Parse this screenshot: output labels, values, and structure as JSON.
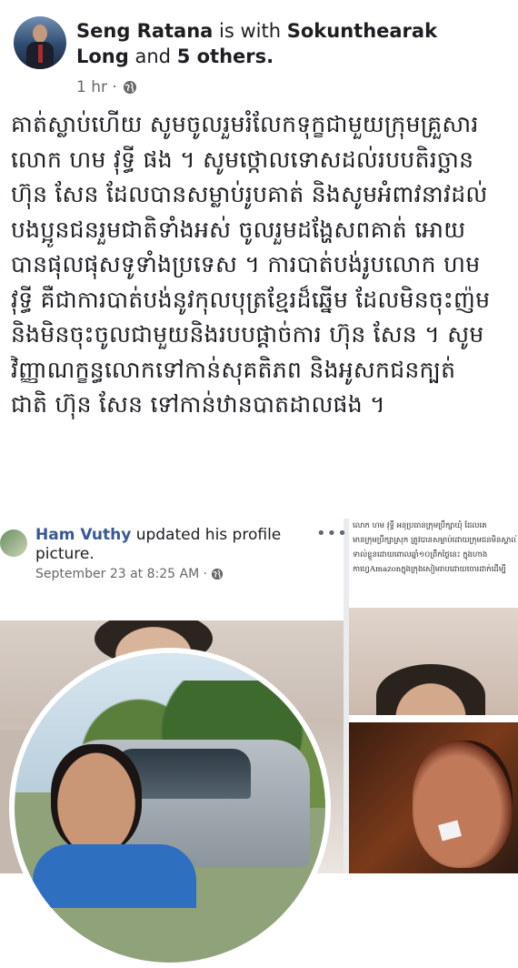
{
  "post": {
    "author": "Seng Ratana",
    "with_word": "is with",
    "tagged": "Sokunthearak",
    "tagged2": "Long",
    "and_word": "and",
    "others": "5 others.",
    "time": "1 hr ·",
    "privacy_icon": "globe-icon",
    "lines": [
      "គាត់ស្លាប់ហើយ សូមចូលរួមរំលែកទុក្ខជាមួយក្រុមគ្រួសារ",
      "លោក ហម វុទ្ធី ផង ។ សូមថ្កោលទោសដល់របបតិរច្ឆាន",
      "ហ៊ុន សែន ដែលបានសម្លាប់រូបគាត់ និងសូមអំពាវនាវដល់",
      "បងប្អូនជនរួមជាតិទាំងអស់ ចូលរួមដង្ហែសពគាត់ អោយ",
      "បានផុលផុសទូទាំងប្រទេស ។ ការបាត់បង់រូបលោក ហម",
      "វុទ្ធី គឺជាការបាត់បង់នូវកុលបុត្រខ្មែរដ៏ឆ្នើម ដែលមិនចុះញ៉ម",
      "និងមិនចុះចូលជាមួយនិងរបបផ្តាច់ការ ហ៊ុន សែន ។ សូម",
      "វិញ្ញាណក្ខន្ធលោកទៅកាន់សុគតិភព និងអូសកជនក្បត់",
      "ជាតិ ហ៊ុន សែន ទៅកាន់ឋានបាតដាលផង ។"
    ]
  },
  "shared_post": {
    "name": "Ham Vuthy",
    "action": "updated his profile picture.",
    "time": "September 23 at 8:25 AM ·",
    "more": "•••",
    "snippet": [
      "លោក ហម វុទ្ធី អនុប្រធានក្រុមប្រឹក្សាឃុំ ដែលគេ",
      "មានក្រុមប្រឹក្សាស្រុក ត្រូវបានសម្លាប់ដោយក្រុមជនមិនស្គាល់",
      "ទាល់ខ្លួនដោយពោលឆ្នាំ១០ព្រឹកថ្ងៃនេះ ក្នុងហាង",
      "កាហ្វេAmazonក្នុងក្រុងសៀមរាបដោយចោរដាក់ដើម្បី"
    ]
  }
}
